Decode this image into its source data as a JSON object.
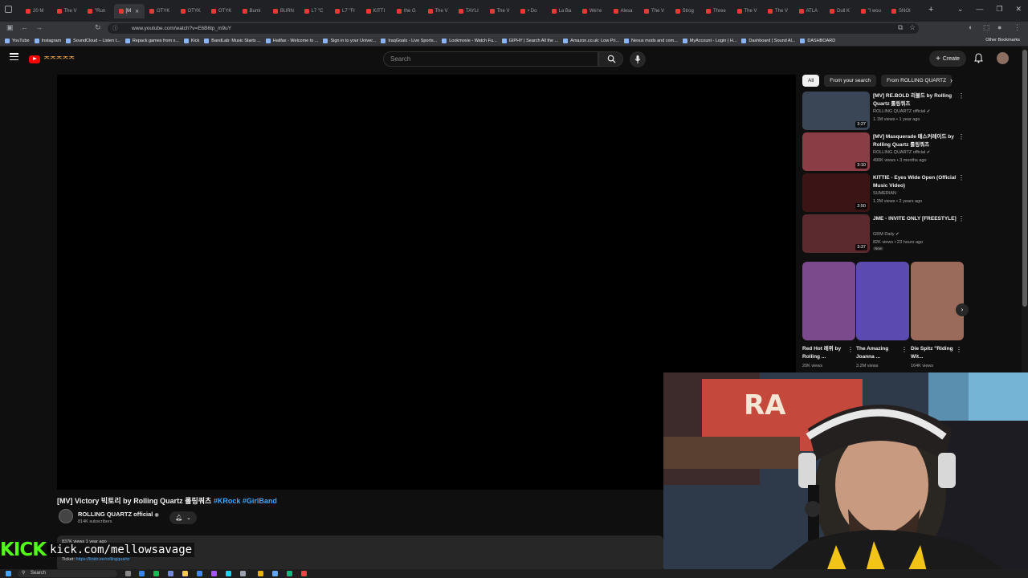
{
  "browser": {
    "tabs": [
      {
        "label": "20 M"
      },
      {
        "label": "The V"
      },
      {
        "label": "\"Run"
      },
      {
        "label": "[M",
        "active": true
      },
      {
        "label": "OTYK"
      },
      {
        "label": "OTYK"
      },
      {
        "label": "OTYK"
      },
      {
        "label": "Burni"
      },
      {
        "label": "BURN"
      },
      {
        "label": "L7 \"C"
      },
      {
        "label": "L7 \"Fr"
      },
      {
        "label": "KITTI"
      },
      {
        "label": "the G"
      },
      {
        "label": "The V"
      },
      {
        "label": "TAYLI"
      },
      {
        "label": "The V"
      },
      {
        "label": "• Do"
      },
      {
        "label": "La Ba"
      },
      {
        "label": "We're"
      },
      {
        "label": "Alesa"
      },
      {
        "label": "The V"
      },
      {
        "label": "Strog"
      },
      {
        "label": "Three"
      },
      {
        "label": "The V"
      },
      {
        "label": "The V"
      },
      {
        "label": "ATLA"
      },
      {
        "label": "Dull K"
      },
      {
        "label": "\"I wou"
      },
      {
        "label": "SNOI"
      }
    ],
    "url": "www.youtube.com/watch?v=E6B6tp_m9uY",
    "bookmarks": [
      "YouTube",
      "Instagram",
      "SoundCloud – Listen t...",
      "Repack games from x...",
      "Kick",
      "BandLab: Music Starts ...",
      "Halifax - Welcome to ...",
      "Sign in to your Univer...",
      "IraqGoals - Live Sports...",
      "Lookmovie - Watch Fu...",
      "GIPHY | Search All the ...",
      "Amazon.co.uk: Low Pri...",
      "Nexus mods and com...",
      "MyAccount - Login | H...",
      "Dashboard | Sound Al...",
      "DASHBOARD"
    ],
    "other_bookmarks": "Other Bookmarks"
  },
  "masthead": {
    "logo_text": "ᄌᄌᄌᄌᄌ",
    "search_placeholder": "Search",
    "create_label": "Create"
  },
  "video": {
    "title_main": "[MV] Victory 빅토리 by Rolling Quartz 롤링쿼츠 ",
    "title_tags": "#KRock #GirlBand",
    "channel_name": "ROLLING QUARTZ official",
    "channel_subs": "814K subscribers",
    "desc_meta": "837K views  1 year ago",
    "desc_ticket_label": "Ticket: ",
    "desc_ticket_link": "https://linktr.ee/rollingquartz"
  },
  "sidebar": {
    "chips": [
      {
        "label": "All",
        "selected": true
      },
      {
        "label": "From your search"
      },
      {
        "label": "From ROLLING QUARTZ"
      }
    ],
    "recommendations": [
      {
        "title": "[MV] RE.BOLD 리볼드 by Rolling Quartz 롤링쿼츠",
        "channel": "ROLLING QUARTZ official ✔",
        "meta": "1.1M views • 1 year ago",
        "duration": "3:27",
        "thumb_color": "#3a4556"
      },
      {
        "title": "[MV] Masquerade 매스커레이드 by Rolling Quartz 롤링쿼츠",
        "channel": "ROLLING QUARTZ official ✔",
        "meta": "490K views • 3 months ago",
        "duration": "3:10",
        "thumb_color": "#8a3d45"
      },
      {
        "title": "KITTIE - Eyes Wide Open (Official Music Video)",
        "channel": "SUMERIAN",
        "meta": "1.2M views • 2 years ago",
        "duration": "3:50",
        "thumb_color": "#3b1416"
      },
      {
        "title": "JME - INVITE ONLY [FREESTYLE]",
        "channel": "GRM Daily ✔",
        "meta": "82K views • 23 hours ago",
        "duration": "3:37",
        "thumb_color": "#5a2a2e",
        "badge": "New"
      }
    ],
    "shorts": [
      {
        "title": "Red Hot 레위 by Rolling ...",
        "views": "20K views",
        "thumb_color": "#7a4a8c"
      },
      {
        "title": "The Amazing Joanna ...",
        "views": "3.2M views",
        "thumb_color": "#5b4ab0"
      },
      {
        "title": "Die Spitz \"Riding Wit...",
        "views": "164K views",
        "thumb_color": "#9a6a5a"
      }
    ]
  },
  "overlay": {
    "kick_logo": "KICK",
    "kick_url": "kick.com/mellowsavage"
  },
  "taskbar": {
    "search_label": "Search"
  },
  "colors": {
    "background": "#0f0f0f",
    "kick_green": "#53fc18",
    "link_blue": "#3ea6ff",
    "youtube_red": "#ff0000"
  }
}
